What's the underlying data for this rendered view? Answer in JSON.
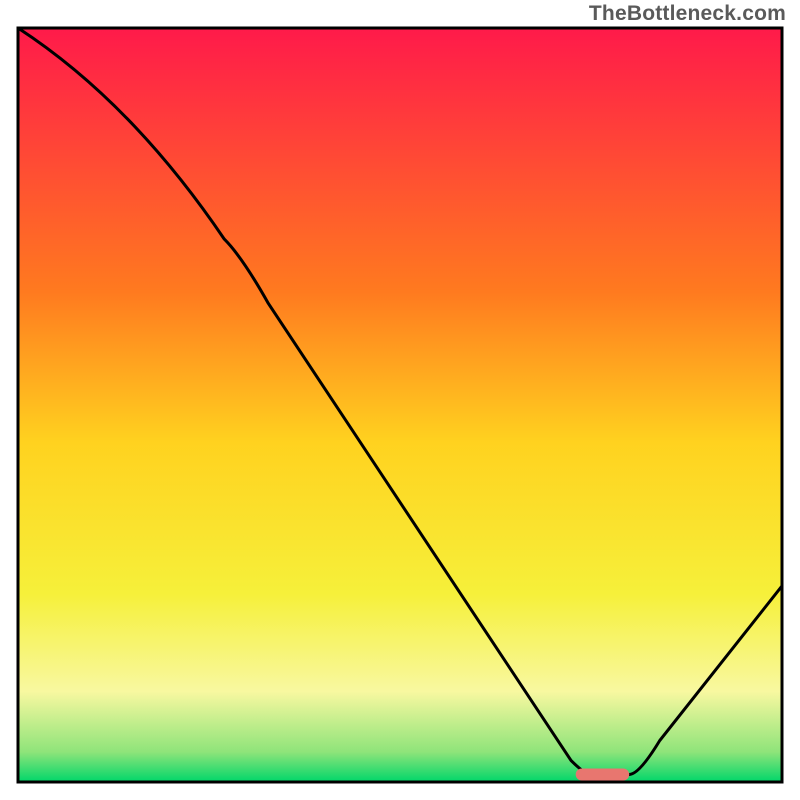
{
  "watermark": "TheBottleneck.com",
  "chart_data": {
    "type": "line",
    "title": "",
    "xlabel": "",
    "ylabel": "",
    "xlim": [
      0,
      100
    ],
    "ylim": [
      0,
      100
    ],
    "x": [
      0,
      27,
      75,
      80,
      100
    ],
    "values": [
      100,
      72,
      1,
      1,
      26
    ],
    "optimal_segment": {
      "x_start": 73,
      "x_end": 80,
      "y": 1
    },
    "gradient_stops": [
      {
        "offset": 0,
        "color": "#ff1a4a"
      },
      {
        "offset": 35,
        "color": "#ff7a1f"
      },
      {
        "offset": 55,
        "color": "#ffd21f"
      },
      {
        "offset": 75,
        "color": "#f6f03a"
      },
      {
        "offset": 88,
        "color": "#f8f8a0"
      },
      {
        "offset": 96,
        "color": "#8fe47a"
      },
      {
        "offset": 100,
        "color": "#00d66a"
      }
    ],
    "border_color": "#000000",
    "curve_color": "#000000",
    "marker_color": "#e8766f"
  }
}
